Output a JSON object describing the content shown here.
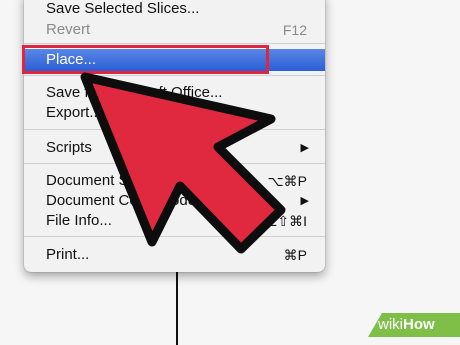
{
  "menu": {
    "items": [
      {
        "label": "Save Selected Slices...",
        "shortcut": "",
        "state": "enabled"
      },
      {
        "label": "Revert",
        "shortcut": "F12",
        "state": "disabled"
      },
      {
        "label": "Place...",
        "shortcut": "",
        "state": "highlighted"
      },
      {
        "label": "Save for Microsoft Office...",
        "shortcut": "",
        "state": "enabled"
      },
      {
        "label": "Export...",
        "shortcut": "",
        "state": "enabled"
      },
      {
        "label": "Scripts",
        "shortcut": "",
        "state": "enabled",
        "submenu": true
      },
      {
        "label": "Document Setup...",
        "shortcut": "⌥⌘P",
        "state": "enabled"
      },
      {
        "label": "Document Color Mode",
        "shortcut": "",
        "state": "enabled",
        "submenu": true
      },
      {
        "label": "File Info...",
        "shortcut": "⌥⇧⌘I",
        "state": "enabled"
      },
      {
        "label": "Print...",
        "shortcut": "⌘P",
        "state": "enabled"
      }
    ]
  },
  "colors": {
    "highlight": "#2a5fd6",
    "annotation_box": "#e0263c",
    "arrow_fill": "#e0283e",
    "watermark": "#7fbf48"
  },
  "watermark": {
    "prefix": "wiki",
    "brand": "How"
  }
}
